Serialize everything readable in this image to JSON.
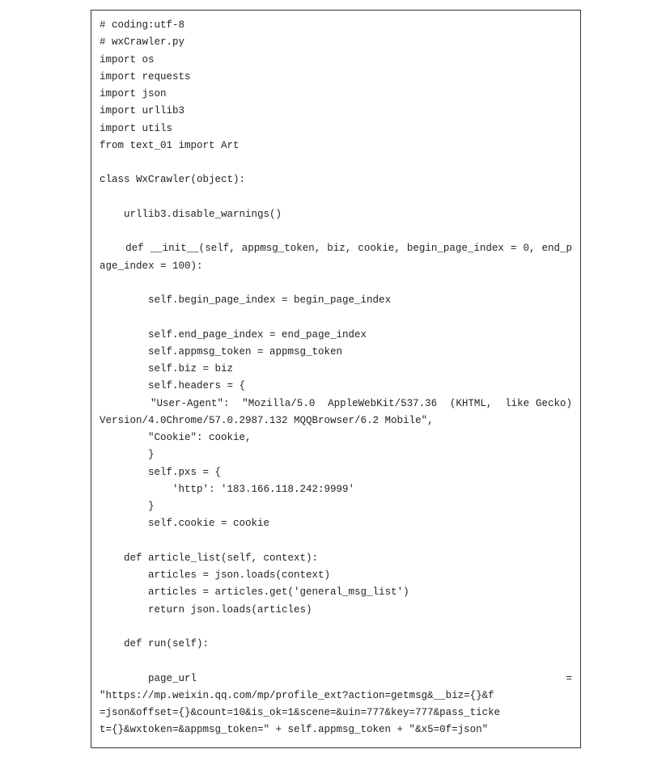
{
  "code": {
    "l1": "# coding:utf-8",
    "l2": "# wxCrawler.py",
    "l3": "import os",
    "l4": "import requests",
    "l5": "import json",
    "l6": "import urllib3",
    "l7": "import utils",
    "l8": "from text_01 import Art",
    "l9": "",
    "l10": "class WxCrawler(object):",
    "l11": "",
    "l12": "    urllib3.disable_warnings()",
    "l13": "",
    "l14a": "    def __init__(self, appmsg_token, biz, cookie, begin_page_index = ",
    "l14b": "0, end_page_index = 100):",
    "l15": "",
    "l16": "        self.begin_page_index = begin_page_index",
    "l17": "",
    "l18": "        self.end_page_index = end_page_index",
    "l19": "        self.appmsg_token = appmsg_token",
    "l20": "        self.biz = biz",
    "l21": "        self.headers = {",
    "l22a": "        \"User-Agent\":  \"Mozilla/5.0  AppleWebKit/537.36  (KHTML,  like ",
    "l22b": "Gecko) Version/4.0Chrome/57.0.2987.132 MQQBrowser/6.2 Mobile\",",
    "l23": "        \"Cookie\": cookie,",
    "l24": "        }",
    "l25": "        self.pxs = {",
    "l26": "            'http': '183.166.118.242:9999'",
    "l27": "        }",
    "l28": "        self.cookie = cookie",
    "l29": "",
    "l30": "    def article_list(self, context):",
    "l31": "        articles = json.loads(context)",
    "l32": "        articles = articles.get('general_msg_list')",
    "l33": "        return json.loads(articles)",
    "l34": "",
    "l35": "    def run(self):",
    "l36": "",
    "l37a": "        page_url",
    "l37b": "=",
    "l38": "\"https://mp.weixin.qq.com/mp/profile_ext?action=getmsg&__biz={}&f",
    "l38b": "=json&offset={}&count=10&is_ok=1&scene=&uin=777&key=777&pass_ticke",
    "l38c": "t={}&wxtoken=&appmsg_token=\" + self.appmsg_token + \"&x5=0f=json\""
  }
}
